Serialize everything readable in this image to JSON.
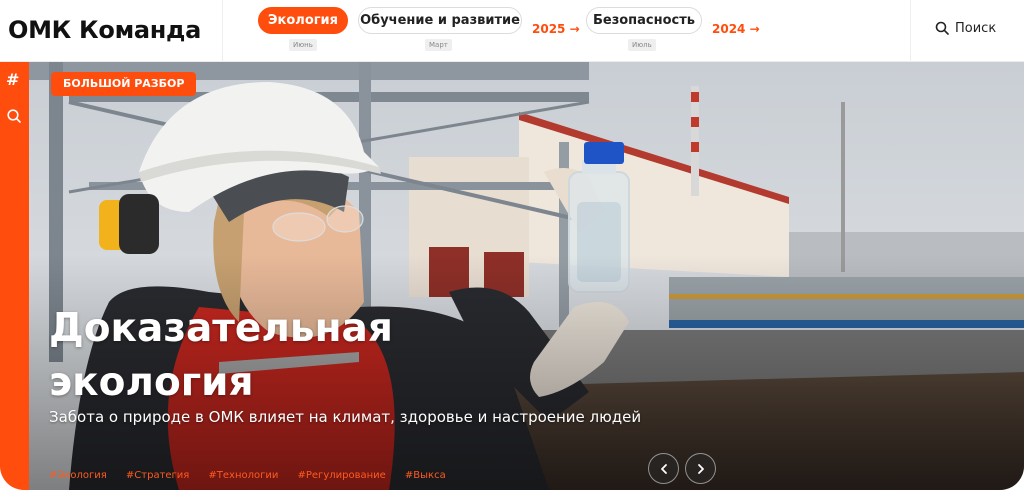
{
  "header": {
    "logo": "ОМК Команда",
    "nav": [
      {
        "label": "Экология",
        "sub": "Июнь",
        "active": true
      },
      {
        "label": "Обучение и развитие",
        "sub": "Март",
        "active": false
      },
      {
        "label": "Безопасность",
        "sub": "Июль",
        "active": false
      }
    ],
    "years": [
      "2025 →",
      "2024 →"
    ],
    "search_label": "Поиск"
  },
  "rail": {
    "hash": "#"
  },
  "hero": {
    "badge": "БОЛЬШОЙ РАЗБОР",
    "title_line1": "Доказательная",
    "title_line2": "экология",
    "subtitle": "Забота о природе в ОМК влияет на климат, здоровье и настроение людей",
    "tags": [
      "#Экология",
      "#Стратегия",
      "#Технологии",
      "#Регулирование",
      "#Выкса"
    ],
    "prev_icon": "chevron-left-icon",
    "next_icon": "chevron-right-icon"
  },
  "colors": {
    "accent": "#ff4d0d"
  }
}
